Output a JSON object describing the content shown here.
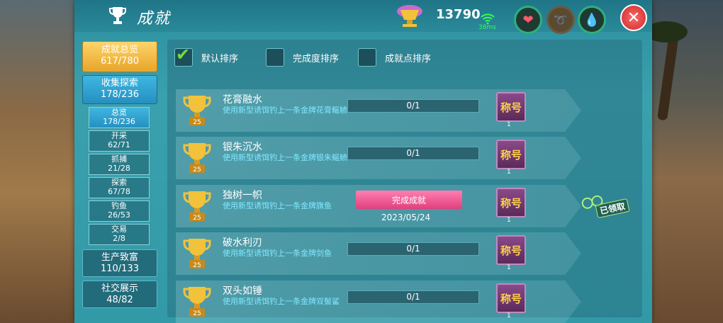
{
  "header": {
    "title": "成就",
    "coins": "13790",
    "ping": "38ms"
  },
  "nav": {
    "overview": {
      "label": "成就总览",
      "count": "617/780"
    },
    "collect": {
      "label": "收集探索",
      "count": "178/236"
    },
    "subs": [
      {
        "label": "总览",
        "count": "178/236"
      },
      {
        "label": "开采",
        "count": "62/71"
      },
      {
        "label": "抓捕",
        "count": "21/28"
      },
      {
        "label": "探索",
        "count": "67/78"
      },
      {
        "label": "钓鱼",
        "count": "26/53"
      },
      {
        "label": "交易",
        "count": "2/8"
      }
    ],
    "production": {
      "label": "生产致富",
      "count": "110/133"
    },
    "social": {
      "label": "社交展示",
      "count": "48/82"
    }
  },
  "sort": {
    "default": "默认排序",
    "completion": "完成度排序",
    "points": "成就点排序"
  },
  "achievements": [
    {
      "name": "花膏融水",
      "desc": "使用新型诱饵钓上一条金牌花膏鳐鲼",
      "progress": "0/1",
      "points": "25",
      "reward": "称号",
      "reward_count": "1"
    },
    {
      "name": "银朱沉水",
      "desc": "使用新型诱饵钓上一条金牌银朱鳐鲼",
      "progress": "0/1",
      "points": "25",
      "reward": "称号",
      "reward_count": "1"
    },
    {
      "name": "独树一帜",
      "desc": "使用新型诱饵钓上一条金牌旗鱼",
      "status": "完成成就",
      "date": "2023/05/24",
      "points": "25",
      "reward": "称号",
      "reward_count": "1"
    },
    {
      "name": "破水利刃",
      "desc": "使用新型诱饵钓上一条金牌剑鱼",
      "progress": "0/1",
      "points": "25",
      "reward": "称号",
      "reward_count": "1"
    },
    {
      "name": "双头如锤",
      "desc": "使用新型诱饵钓上一条金牌双髻鲨",
      "progress": "0/1",
      "points": "25",
      "reward": "称号",
      "reward_count": "1"
    }
  ],
  "claimed_label": "已领取"
}
